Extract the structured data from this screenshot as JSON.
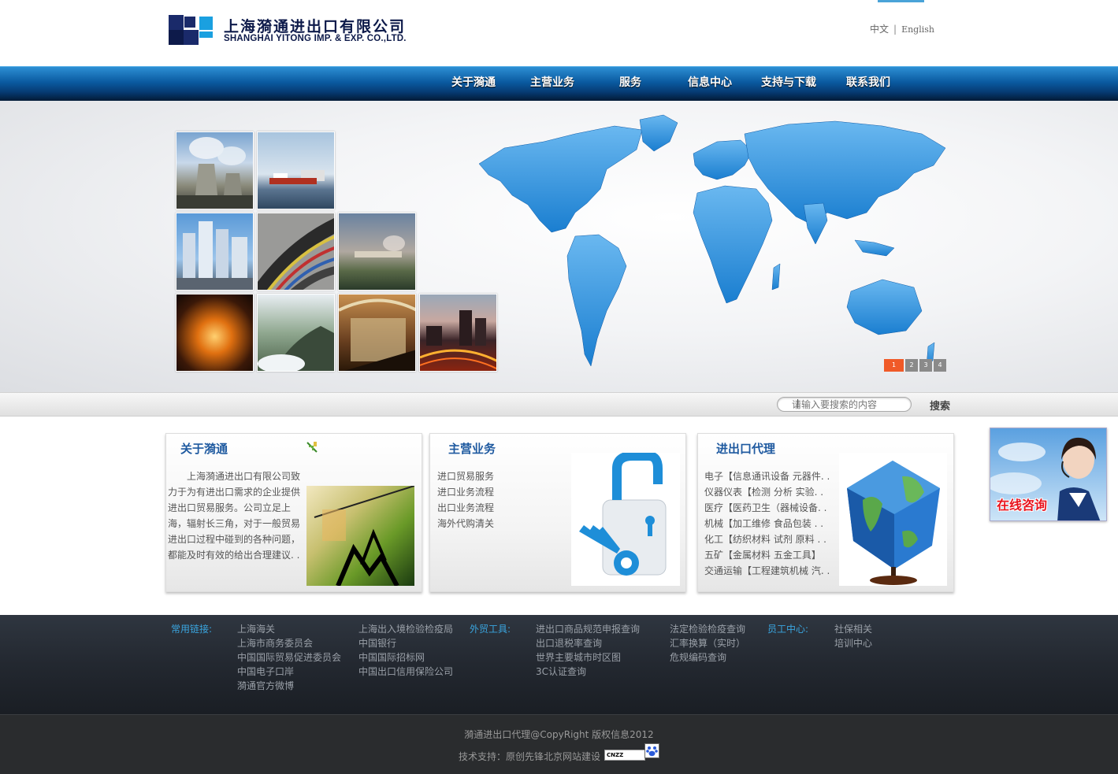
{
  "header": {
    "logo_cn": "上海漪通进出口有限公司",
    "logo_en": "SHANGHAI YITONG IMP. & EXP. CO.,LTD.",
    "lang_cn": "中文",
    "lang_sep": "|",
    "lang_en": "English"
  },
  "nav": {
    "items": [
      {
        "label": "关于漪通"
      },
      {
        "label": "主营业务"
      },
      {
        "label": "服务"
      },
      {
        "label": "信息中心"
      },
      {
        "label": "支持与下载"
      },
      {
        "label": "联系我们"
      }
    ]
  },
  "banner": {
    "pager": [
      "1",
      "2",
      "3",
      "4"
    ],
    "active_page": "1"
  },
  "search": {
    "placeholder": "请输入要搜索的内容",
    "button": "搜索"
  },
  "panels": {
    "about": {
      "title": "关于漪通",
      "text": "上海漪通进出口有限公司致力于为有进出口需求的企业提供进出口贸易服务。公司立足上海，辐射长三角，对于一般贸易进出口过程中碰到的各种问题，都能及时有效的给出合理建议. ."
    },
    "business": {
      "title": "主营业务",
      "items": [
        "进口贸易服务",
        "进口业务流程",
        "出口业务流程",
        "海外代购清关"
      ]
    },
    "agency": {
      "title": "进出口代理",
      "items": [
        "电子【信息通讯设备 元器件. .",
        "仪器仪表【检测 分析 实验. .",
        "医疗【医药卫生（器械设备. .",
        "机械【加工维修 食品包装 . .",
        "化工【纺织材料 试剂 原料 . .",
        "五矿【金属材料 五金工具】",
        "交通运输【工程建筑机械 汽. ."
      ]
    }
  },
  "consult": {
    "label": "在线咨询"
  },
  "links": {
    "common_head": "常用链接:",
    "common_col1": [
      "上海海关",
      "上海市商务委员会",
      "中国国际贸易促进委员会",
      "中国电子口岸",
      "漪通官方微博"
    ],
    "common_col2": [
      "上海出入境检验检疫局",
      "中国银行",
      "中国国际招标网",
      "中国出口信用保险公司"
    ],
    "trade_head": "外贸工具:",
    "trade_col1": [
      "进出口商品规范申报查询",
      "出口退税率查询",
      "世界主要城市时区图",
      "3C认证查询"
    ],
    "trade_col2": [
      "法定检验检疫查询",
      "汇率换算（实时）",
      "危规编码查询"
    ],
    "staff_head": "员工中心:",
    "staff_col": [
      "社保相关",
      "培训中心"
    ]
  },
  "footer": {
    "copyright": "漪通进出口代理@CopyRight 版权信息2012",
    "tech": "技术支持：原创先锋北京网站建设",
    "cnzz": "CNZZ"
  },
  "colors": {
    "nav_blue": "#0a5aa0",
    "title_blue": "#1f5aa0",
    "link_blue": "#3aa6e0",
    "pager_active": "#f05a28"
  }
}
